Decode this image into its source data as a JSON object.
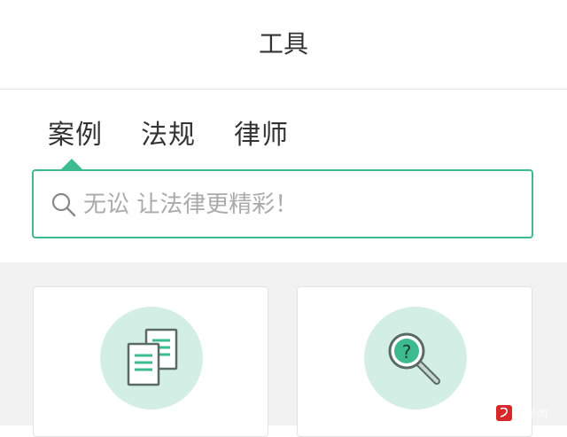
{
  "header": {
    "title": "工具"
  },
  "tabs": [
    {
      "label": "案例",
      "active": true
    },
    {
      "label": "法规",
      "active": false
    },
    {
      "label": "律师",
      "active": false
    }
  ],
  "search": {
    "placeholder": "无讼 让法律更精彩！",
    "icon": "search-icon"
  },
  "cards": [
    {
      "icon": "documents-icon"
    },
    {
      "icon": "magnifier-question-icon"
    }
  ],
  "watermark": {
    "logo": "齐鲁",
    "text": "壹新闻"
  },
  "colors": {
    "accent": "#3cbb8e",
    "icon_bg": "#d3efe5",
    "content_bg": "#f2f2f2"
  }
}
